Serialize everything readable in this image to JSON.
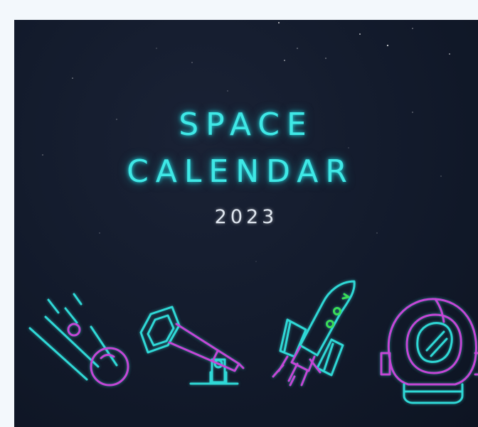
{
  "poster": {
    "title_line_1": "SPACE",
    "title_line_2": "CALENDAR",
    "year": "2023"
  },
  "icons": [
    "comet-icon",
    "telescope-icon",
    "rocket-icon",
    "astronaut-helmet-icon"
  ],
  "colors": {
    "background": "#121a2b",
    "title": "#3fe8e6",
    "year": "#dfe6ef",
    "neon_cyan": "#2fd8d6",
    "neon_magenta": "#c446d6",
    "neon_green": "#3bdc55",
    "page_background": "#f3f8fc"
  }
}
